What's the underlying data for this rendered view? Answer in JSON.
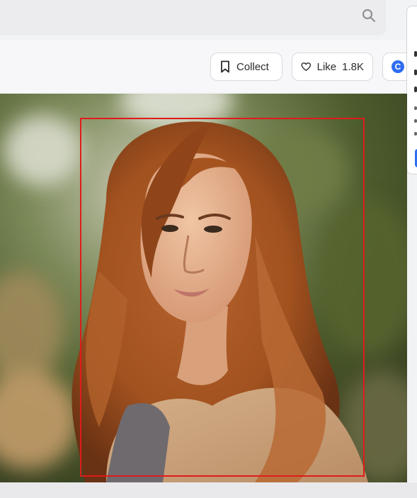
{
  "search": {
    "icon": "search-icon"
  },
  "actions": {
    "collect_label": "Collect",
    "like_label": "Like",
    "like_count": "1.8K",
    "extra_icon_letter": "C"
  },
  "colors": {
    "accent": "#2f6df2",
    "selection_box": "#e01b1b"
  },
  "photo": {
    "icon": "portrait-photo"
  }
}
